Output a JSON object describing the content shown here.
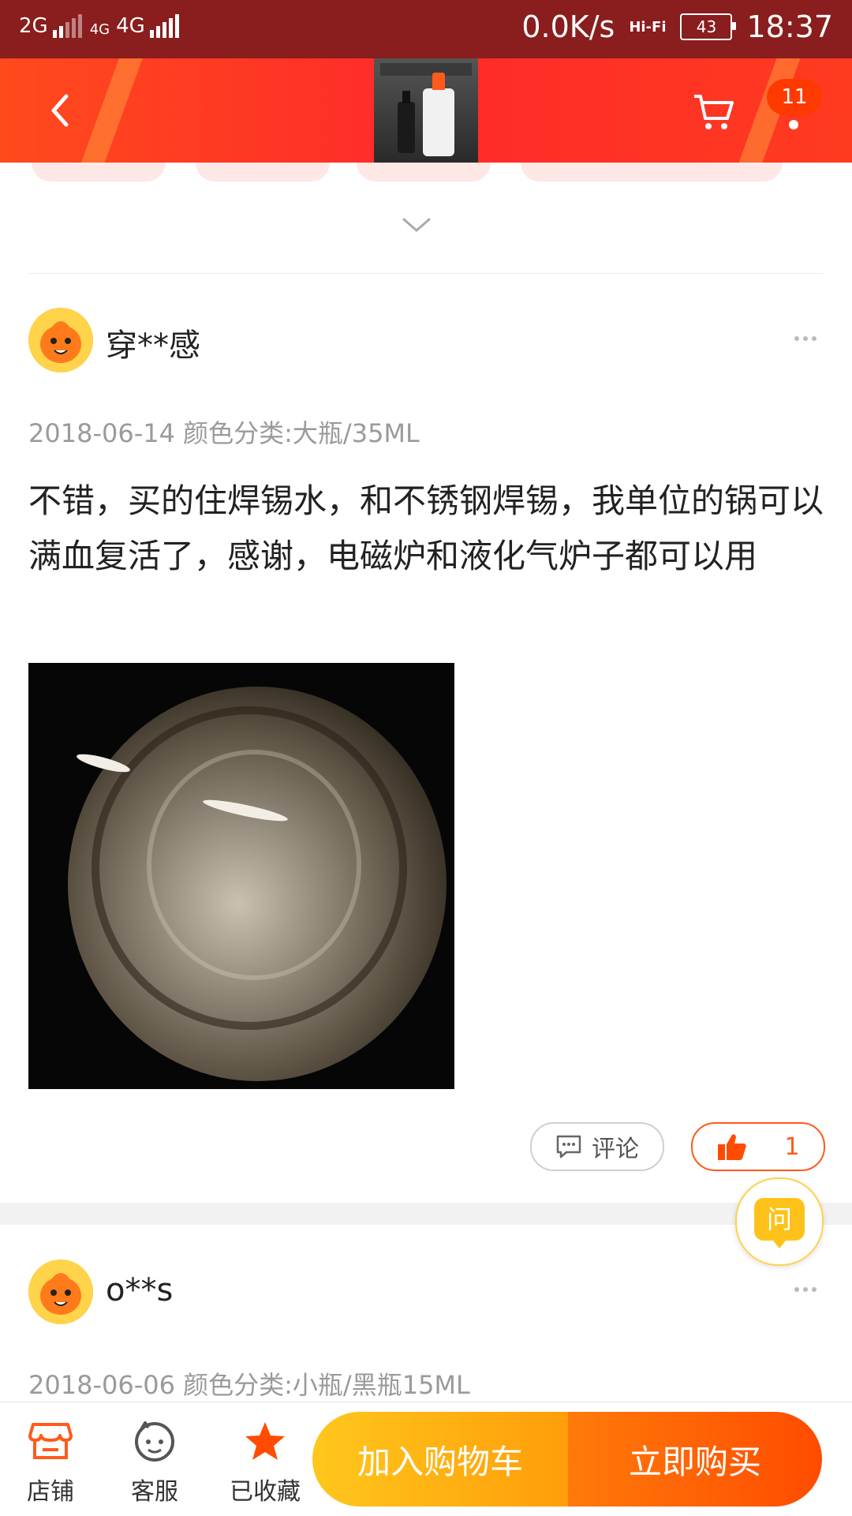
{
  "status_bar": {
    "network_left": "2G",
    "network_mid": "4G",
    "network_right": "4G",
    "speed": "0.0K/s",
    "hifi": "Hi-Fi",
    "battery": "43",
    "time": "18:37"
  },
  "header": {
    "cart_badge": "11",
    "accent": "#ff2a2a"
  },
  "reviews": [
    {
      "username": "穿**感",
      "meta": "2018-06-14 颜色分类:大瓶/35ML",
      "text": "不错，买的住焊锡水，和不锈钢焊锡，我单位的锅可以满血复活了，感谢，电磁炉和液化气炉子都可以用",
      "comment_label": "评论",
      "likes": "1"
    },
    {
      "username": "o**s",
      "meta": "2018-06-06 颜色分类:小瓶/黑瓶15ML"
    }
  ],
  "ask_button": {
    "label": "问"
  },
  "bottom_bar": {
    "store_label": "店铺",
    "service_label": "客服",
    "favorite_label": "已收藏",
    "add_to_cart_label": "加入购物车",
    "buy_now_label": "立即购买"
  },
  "icons": [
    "back-icon",
    "cart-icon",
    "chevron-down-icon",
    "more-icon",
    "comment-icon",
    "thumbs-up-icon",
    "store-icon",
    "service-icon",
    "star-icon"
  ]
}
